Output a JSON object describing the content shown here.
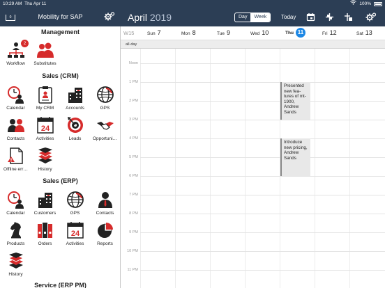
{
  "status_bar": {
    "time": "10:29 AM",
    "date": "Thu Apr 11",
    "battery": "100%"
  },
  "sidebar_header": {
    "title": "Mobility for SAP",
    "tray_label": "0"
  },
  "calendar_header": {
    "month": "April",
    "year": "2019",
    "view_day": "Day",
    "view_week": "Week",
    "today": "Today"
  },
  "sections": {
    "management": "Management",
    "crm": "Sales (CRM)",
    "erp": "Sales (ERP)",
    "service": "Service (ERP PM)"
  },
  "tiles": {
    "workflow": "Workflow",
    "workflow_badge": "2",
    "substitutes": "Substitutes",
    "crm_calendar": "Calendar",
    "crm_mycrm": "My CRM",
    "crm_accounts": "Accounts",
    "crm_gps": "GPS",
    "crm_contacts": "Contacts",
    "crm_activities": "Activities",
    "crm_activities_day": "24",
    "crm_leads": "Leads",
    "crm_opportunities": "Opportuni…",
    "crm_offline": "Offline err…",
    "crm_history": "History",
    "erp_calendar": "Calendar",
    "erp_customers": "Customers",
    "erp_gps": "GPS",
    "erp_contacts": "Contacts",
    "erp_products": "Products",
    "erp_orders": "Orders",
    "erp_activities": "Activities",
    "erp_activities_day": "24",
    "erp_reports": "Reports",
    "erp_history": "History"
  },
  "week": {
    "label": "W15",
    "days": [
      {
        "name": "Sun",
        "num": "7"
      },
      {
        "name": "Mon",
        "num": "8"
      },
      {
        "name": "Tue",
        "num": "9"
      },
      {
        "name": "Wed",
        "num": "10"
      },
      {
        "name": "Thu",
        "num": "11"
      },
      {
        "name": "Fri",
        "num": "12"
      },
      {
        "name": "Sat",
        "num": "13"
      }
    ],
    "all_day": "all-day",
    "hours": [
      "Noon",
      "1 PM",
      "2 PM",
      "3 PM",
      "4 PM",
      "5 PM",
      "6 PM",
      "7 PM",
      "8 PM",
      "9 PM",
      "10 PM",
      "11 PM"
    ]
  },
  "events": [
    {
      "title": "Presented new fea­tures of mt-1900, Andrew Sands",
      "day": "Thu",
      "start": "1 PM",
      "end": "3 PM"
    },
    {
      "title": "Introduce new pricing, An­drew Sands",
      "day": "Thu",
      "start": "4 PM",
      "end": "6 PM"
    }
  ],
  "colors": {
    "header": "#2c3e55",
    "accent_red": "#d62b2b",
    "today_blue": "#1e88e5"
  }
}
